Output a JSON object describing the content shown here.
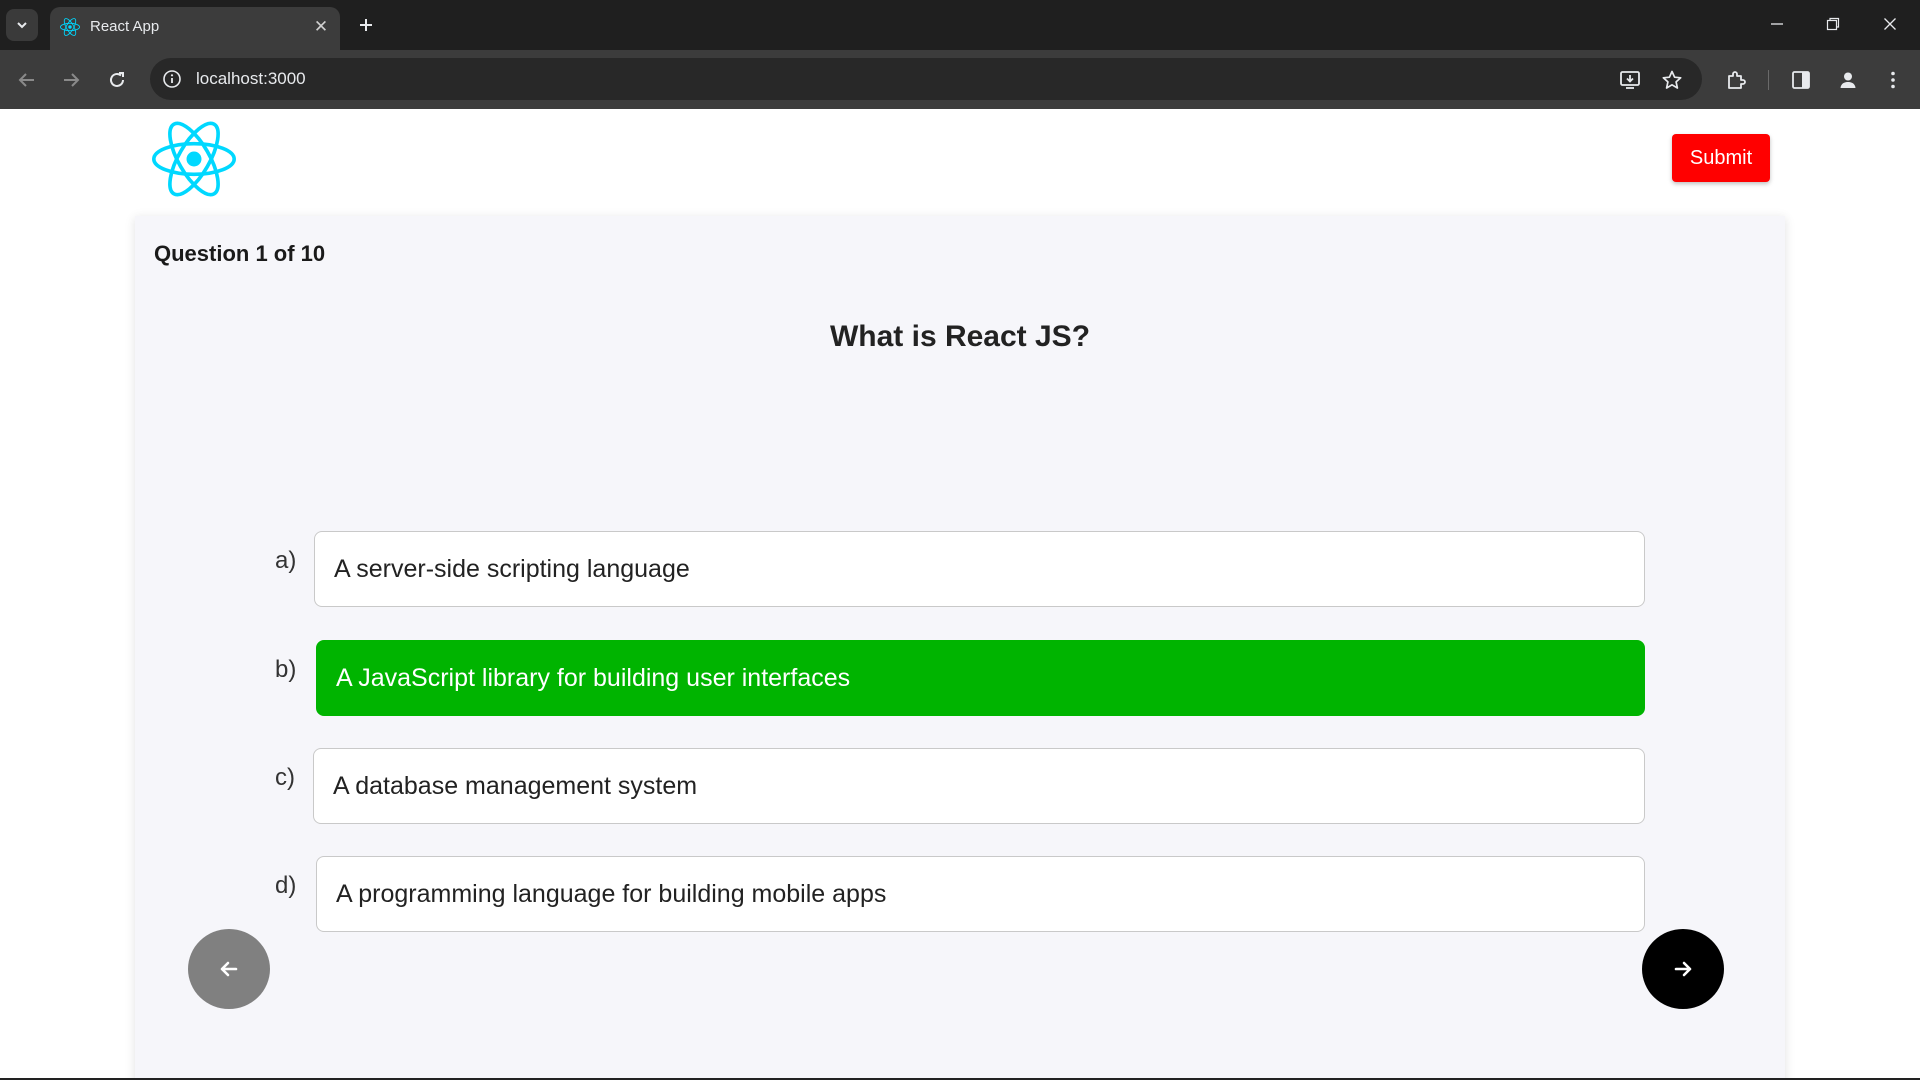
{
  "browser": {
    "tab_title": "React App",
    "url": "localhost:3000"
  },
  "header": {
    "logo_name": "react-logo",
    "submit_label": "Submit"
  },
  "quiz": {
    "counter": "Question 1 of 10",
    "question": "What is React JS?",
    "options": [
      {
        "letter": "a)",
        "text": "A server-side scripting language",
        "selected": false
      },
      {
        "letter": "b)",
        "text": "A JavaScript library for building user interfaces",
        "selected": true
      },
      {
        "letter": "c)",
        "text": "A database management system",
        "selected": false
      },
      {
        "letter": "d)",
        "text": "A programming language for building mobile apps",
        "selected": false
      }
    ]
  },
  "colors": {
    "selected_option": "#00b400",
    "submit_button": "#ff0000",
    "react_cyan": "#00d8ff",
    "prev_button": "#808080",
    "next_button": "#000000"
  },
  "icons": {
    "prev": "arrow-left-icon",
    "next": "arrow-right-icon"
  }
}
